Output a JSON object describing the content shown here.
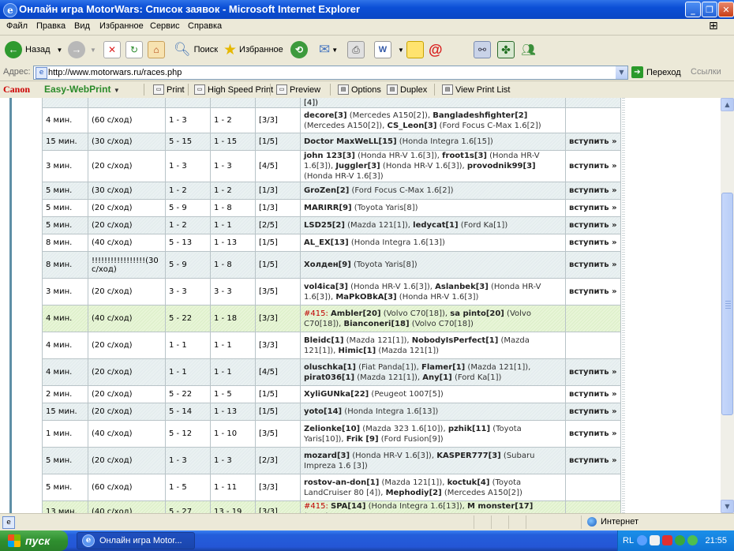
{
  "window": {
    "title": "Онлайн игра MotorWars: Список заявок - Microsoft Internet Explorer"
  },
  "menu": [
    "Файл",
    "Правка",
    "Вид",
    "Избранное",
    "Сервис",
    "Справка"
  ],
  "toolbar": {
    "back": "Назад",
    "search": "Поиск",
    "favorites": "Избранное"
  },
  "address": {
    "label": "Адрес:",
    "url": "http://www.motorwars.ru/races.php",
    "go": "Переход",
    "links": "Ссылки"
  },
  "canonbar": {
    "brand": "Canon",
    "product": "Easy-WebPrint",
    "print": "Print",
    "high_speed": "High Speed Print",
    "preview": "Preview",
    "options": "Options",
    "duplex": "Duplex",
    "view_list": "View Print List"
  },
  "races": {
    "top_partial": "[4])",
    "rows": [
      {
        "style": "odd",
        "time": "4 мин.",
        "move": "(60 с/ход)",
        "lvl": "1 - 3",
        "cnt": "1 - 2",
        "slots": "[3/3]",
        "players": [
          {
            "n": "decore[3]",
            "c": " (Mercedes A150[2]), "
          },
          {
            "n": "Bangladeshfighter[2]",
            "c": " (Mercedes A150[2]), "
          },
          {
            "n": "CS_Leon[3]",
            "c": " (Ford Focus C-Max 1.6[2])"
          }
        ],
        "join": ""
      },
      {
        "style": "even",
        "time": "15 мин.",
        "move": "(30 с/ход)",
        "lvl": "5 - 15",
        "cnt": "1 - 15",
        "slots": "[1/5]",
        "players": [
          {
            "n": "Doctor MaxWeLL[15]",
            "c": " (Honda Integra 1.6[15])"
          }
        ],
        "join": "вступить »"
      },
      {
        "style": "odd",
        "time": "3 мин.",
        "move": "(20 с/ход)",
        "lvl": "1 - 3",
        "cnt": "1 - 3",
        "slots": "[4/5]",
        "players": [
          {
            "n": "john 123[3]",
            "c": " (Honda HR-V 1.6[3]), "
          },
          {
            "n": "froot1s[3]",
            "c": " (Honda HR-V 1.6[3]), "
          },
          {
            "n": "Juggler[3]",
            "c": " (Honda HR-V 1.6[3]), "
          },
          {
            "n": "provodnik99[3]",
            "c": " (Honda HR-V 1.6[3])"
          }
        ],
        "join": "вступить »"
      },
      {
        "style": "even",
        "time": "5 мин.",
        "move": "(30 с/ход)",
        "lvl": "1 - 2",
        "cnt": "1 - 2",
        "slots": "[1/3]",
        "players": [
          {
            "n": "GroZen[2]",
            "c": " (Ford Focus C-Max 1.6[2])"
          }
        ],
        "join": "вступить »"
      },
      {
        "style": "odd",
        "time": "5 мин.",
        "move": "(20 с/ход)",
        "lvl": "5 - 9",
        "cnt": "1 - 8",
        "slots": "[1/3]",
        "players": [
          {
            "n": "MARIRR[9]",
            "c": " (Toyota Yaris[8])"
          }
        ],
        "join": "вступить »"
      },
      {
        "style": "even",
        "time": "5 мин.",
        "move": "(20 с/ход)",
        "lvl": "1 - 2",
        "cnt": "1 - 1",
        "slots": "[2/5]",
        "players": [
          {
            "n": "LSD25[2]",
            "c": " (Mazda 121[1]), "
          },
          {
            "n": "ledycat[1]",
            "c": " (Ford Ka[1])"
          }
        ],
        "join": "вступить »"
      },
      {
        "style": "odd",
        "time": "8 мин.",
        "move": "(40 с/ход)",
        "lvl": "5 - 13",
        "cnt": "1 - 13",
        "slots": "[1/5]",
        "players": [
          {
            "n": "AL_EX[13]",
            "c": " (Honda Integra 1.6[13])"
          }
        ],
        "join": "вступить »"
      },
      {
        "style": "even",
        "time": "8 мин.",
        "move": "!!!!!!!!!!!!!!!!!(30 с/ход)",
        "lvl": "5 - 9",
        "cnt": "1 - 8",
        "slots": "[1/5]",
        "players": [
          {
            "n": "Холден[9]",
            "c": " (Toyota Yaris[8])"
          }
        ],
        "join": "вступить »"
      },
      {
        "style": "odd",
        "time": "3 мин.",
        "move": "(20 с/ход)",
        "lvl": "3 - 3",
        "cnt": "3 - 3",
        "slots": "[3/5]",
        "players": [
          {
            "n": "vol4ica[3]",
            "c": " (Honda HR-V 1.6[3]), "
          },
          {
            "n": "Aslanbek[3]",
            "c": " (Honda HR-V 1.6[3]), "
          },
          {
            "n": "MaPkOBkA[3]",
            "c": " (Honda HR-V 1.6[3])"
          }
        ],
        "join": "вступить »"
      },
      {
        "style": "green",
        "time": "4 мин.",
        "move": "(40 с/ход)",
        "lvl": "5 - 22",
        "cnt": "1 - 18",
        "slots": "[3/3]",
        "num": "#415: ",
        "players": [
          {
            "n": "Ambler[20]",
            "c": " (Volvo C70[18]), "
          },
          {
            "n": "sa pinto[20]",
            "c": " (Volvo C70[18]), "
          },
          {
            "n": "Bianconeri[18]",
            "c": " (Volvo C70[18])"
          }
        ],
        "join": ""
      },
      {
        "style": "odd",
        "time": "4 мин.",
        "move": "(20 с/ход)",
        "lvl": "1 - 1",
        "cnt": "1 - 1",
        "slots": "[3/3]",
        "players": [
          {
            "n": "Bleidc[1]",
            "c": " (Mazda 121[1]), "
          },
          {
            "n": "NobodyIsPerfect[1]",
            "c": " (Mazda 121[1]), "
          },
          {
            "n": "Himic[1]",
            "c": " (Mazda 121[1])"
          }
        ],
        "join": ""
      },
      {
        "style": "even",
        "time": "4 мин.",
        "move": "(20 с/ход)",
        "lvl": "1 - 1",
        "cnt": "1 - 1",
        "slots": "[4/5]",
        "players": [
          {
            "n": "oluschka[1]",
            "c": " (Fiat Panda[1]), "
          },
          {
            "n": "Flamer[1]",
            "c": " (Mazda 121[1]), "
          },
          {
            "n": "pirat036[1]",
            "c": " (Mazda 121[1]), "
          },
          {
            "n": "Any[1]",
            "c": " (Ford Ka[1])"
          }
        ],
        "join": "вступить »"
      },
      {
        "style": "odd",
        "time": "2 мин.",
        "move": "(20 с/ход)",
        "lvl": "5 - 22",
        "cnt": "1 - 5",
        "slots": "[1/5]",
        "players": [
          {
            "n": "XyliGUNka[22]",
            "c": " (Peugeot 1007[5])"
          }
        ],
        "join": "вступить »"
      },
      {
        "style": "even",
        "time": "15 мин.",
        "move": "(20 с/ход)",
        "lvl": "5 - 14",
        "cnt": "1 - 13",
        "slots": "[1/5]",
        "players": [
          {
            "n": "yoto[14]",
            "c": " (Honda Integra 1.6[13])"
          }
        ],
        "join": "вступить »"
      },
      {
        "style": "odd",
        "time": "1 мин.",
        "move": "(40 с/ход)",
        "lvl": "5 - 12",
        "cnt": "1 - 10",
        "slots": "[3/5]",
        "players": [
          {
            "n": "Zelionke[10]",
            "c": " (Mazda 323 1.6[10]), "
          },
          {
            "n": "pzhik[11]",
            "c": " (Toyota Yaris[10]), "
          },
          {
            "n": "Frik [9]",
            "c": " (Ford Fusion[9])"
          }
        ],
        "join": "вступить »"
      },
      {
        "style": "even",
        "time": "5 мин.",
        "move": "(20 с/ход)",
        "lvl": "1 - 3",
        "cnt": "1 - 3",
        "slots": "[2/3]",
        "players": [
          {
            "n": "mozard[3]",
            "c": " (Honda HR-V 1.6[3]), "
          },
          {
            "n": "KASPER777[3]",
            "c": " (Subaru Impreza 1.6 [3])"
          }
        ],
        "join": "вступить »"
      },
      {
        "style": "odd",
        "time": "5 мин.",
        "move": "(60 с/ход)",
        "lvl": "1 - 5",
        "cnt": "1 - 11",
        "slots": "[3/3]",
        "players": [
          {
            "n": "rostov-an-don[1]",
            "c": " (Mazda 121[1]), "
          },
          {
            "n": "koctuk[4]",
            "c": " (Toyota LandCruiser 80 [4]), "
          },
          {
            "n": "Mephodiy[2]",
            "c": " (Mercedes A150[2])"
          }
        ],
        "join": ""
      },
      {
        "style": "green",
        "time": "13 мин.",
        "move": "(40 с/ход)",
        "lvl": "5 - 27",
        "cnt": "13 - 19",
        "slots": "[3/3]",
        "num": "#415: ",
        "players": [
          {
            "n": "SPA[14]",
            "c": " (Honda Integra 1.6[13]), "
          },
          {
            "n": "M monster[17]",
            "c": " (Honda"
          }
        ],
        "join": ""
      }
    ]
  },
  "status": {
    "zone": "Интернет"
  },
  "taskbar": {
    "start": "пуск",
    "item": "Онлайн игра Motor...",
    "lang": "RL",
    "clock": "21:55"
  }
}
